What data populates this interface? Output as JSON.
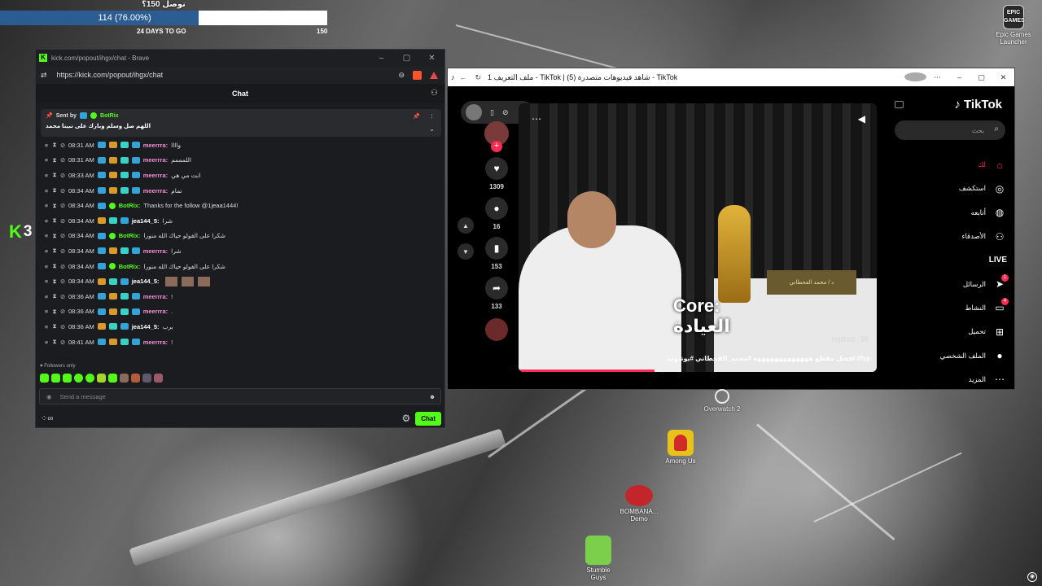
{
  "goal": {
    "title": "نوصل 150؟",
    "progress_text": "114 (76.00%)",
    "progress_fraction": 0.76,
    "days_left": "24 DAYS TO GO",
    "target": "150"
  },
  "overlay": {
    "k_letter": "K",
    "count": "3"
  },
  "chat_window": {
    "title": "kick.com/popout/ihgx/chat - Brave",
    "url": "https://kick.com/popout/ihgx/chat",
    "chat_title": "Chat",
    "pinned": {
      "sent_by_label": "Sent by",
      "sender": "BotRix",
      "text": "اللهم صل وسلم وبارك على نبينا محمد"
    },
    "messages": [
      {
        "time": "08:31 AM",
        "user": "meerrra:",
        "text": "واااا",
        "color": "pink"
      },
      {
        "time": "08:31 AM",
        "user": "meerrra:",
        "text": "اللمممم",
        "color": "pink"
      },
      {
        "time": "08:33 AM",
        "user": "meerrra:",
        "text": "انت مي هي",
        "color": "pink"
      },
      {
        "time": "08:34 AM",
        "user": "meerrra:",
        "text": "تمام",
        "color": "pink"
      },
      {
        "time": "08:34 AM",
        "user": "BotRix:",
        "text": "Thanks for the follow @1jeaa1444!",
        "color": "green"
      },
      {
        "time": "08:34 AM",
        "user": "jea144_5:",
        "text": "شرا",
        "color": "white"
      },
      {
        "time": "08:34 AM",
        "user": "BotRix:",
        "text": "شكرا على الفولو حياك الله منورا",
        "color": "green"
      },
      {
        "time": "08:34 AM",
        "user": "meerrra:",
        "text": "شرا",
        "color": "pink"
      },
      {
        "time": "08:34 AM",
        "user": "BotRix:",
        "text": "شكرا على الفولو حياك الله منورا",
        "color": "green"
      },
      {
        "time": "08:34 AM",
        "user": "jea144_5:",
        "text": "",
        "color": "white",
        "thumbs": 3
      },
      {
        "time": "08:36 AM",
        "user": "meerrra:",
        "text": "!",
        "color": "pink"
      },
      {
        "time": "08:36 AM",
        "user": "meerrra:",
        "text": ".",
        "color": "pink"
      },
      {
        "time": "08:36 AM",
        "user": "jea144_5:",
        "text": "برب",
        "color": "white"
      },
      {
        "time": "08:41 AM",
        "user": "meerrra:",
        "text": "!",
        "color": "pink"
      }
    ],
    "followers_only": "Followers only",
    "send_placeholder": "Send a message",
    "chat_button": "Chat"
  },
  "tiktok_window": {
    "tab_title": "ملف التعريف 1 - TikTok | شاهد فيديوهات متصدرة (5) - TikTok",
    "counts": {
      "likes": "1309",
      "comments": "16",
      "saves": "153",
      "shares": "133"
    },
    "video": {
      "caption_line1": "Core:",
      "caption_line2": "العيادة",
      "handle": "wjdan_38",
      "description": "افضل مقطع هههههههههههههه #محمد_القحطاني #يوتيوب #fyp",
      "sign_text": "د / محمد القحطاني"
    },
    "sidebar": {
      "logo": "TikTok",
      "search_placeholder": "بحث",
      "items": [
        {
          "label": "لك",
          "icon": "home-icon"
        },
        {
          "label": "استكشف",
          "icon": "compass-icon"
        },
        {
          "label": "أتابعه",
          "icon": "following-avatar-icon"
        },
        {
          "label": "الأصدقاء",
          "icon": "friends-icon"
        },
        {
          "label": "LIVE",
          "icon": "live-icon"
        },
        {
          "label": "الرسائل",
          "icon": "messages-icon",
          "badge": "1"
        },
        {
          "label": "النشاط",
          "icon": "activity-icon",
          "badge": "4"
        },
        {
          "label": "تحميل",
          "icon": "upload-icon"
        },
        {
          "label": "الملف الشخصي",
          "icon": "profile-avatar-icon"
        },
        {
          "label": "المزيد",
          "icon": "more-icon"
        }
      ]
    }
  },
  "desktop": {
    "epic": {
      "label_line1": "Epic Games",
      "label_line2": "Launcher",
      "logo_text": "EPIC GAMES"
    },
    "overwatch": "Overwatch 2",
    "amongus": "Among Us",
    "bombana": "BOMBANA... Demo",
    "stumble": "Stumble Guys"
  }
}
